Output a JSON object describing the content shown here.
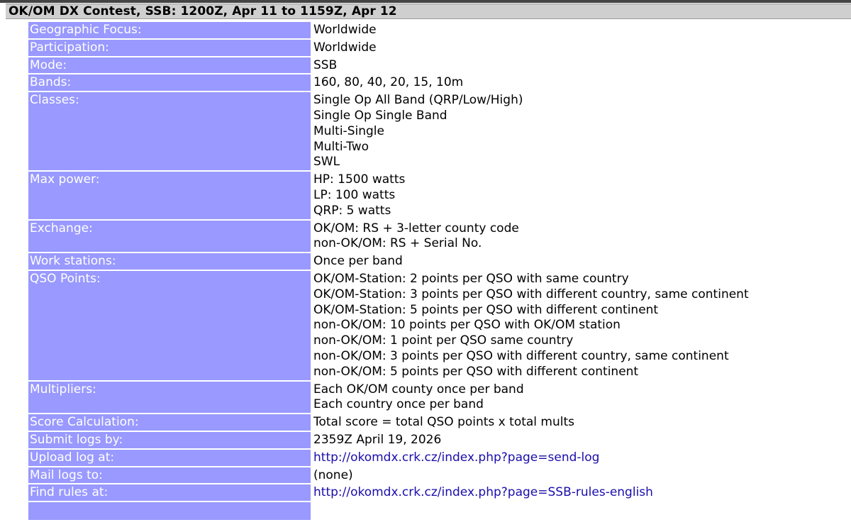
{
  "title": "OK/OM DX Contest, SSB: 1200Z, Apr 11 to 1159Z, Apr 12",
  "rows": [
    {
      "label": "Geographic Focus:",
      "lines": [
        "Worldwide"
      ]
    },
    {
      "label": "Participation:",
      "lines": [
        "Worldwide"
      ]
    },
    {
      "label": "Mode:",
      "lines": [
        "SSB"
      ]
    },
    {
      "label": "Bands:",
      "lines": [
        "160, 80, 40, 20, 15, 10m"
      ]
    },
    {
      "label": "Classes:",
      "lines": [
        "Single Op All Band (QRP/Low/High)",
        "Single Op Single Band",
        "Multi-Single",
        "Multi-Two",
        "SWL"
      ]
    },
    {
      "label": "Max power:",
      "lines": [
        "HP: 1500 watts",
        "LP: 100 watts",
        "QRP: 5 watts"
      ]
    },
    {
      "label": "Exchange:",
      "lines": [
        "OK/OM: RS + 3-letter county code",
        "non-OK/OM: RS + Serial No."
      ]
    },
    {
      "label": "Work stations:",
      "lines": [
        "Once per band"
      ]
    },
    {
      "label": "QSO Points:",
      "lines": [
        "OK/OM-Station: 2 points per QSO with same country",
        "OK/OM-Station: 3 points per QSO with different country, same continent",
        "OK/OM-Station: 5 points per QSO with different continent",
        "non-OK/OM: 10 points per QSO with OK/OM station",
        "non-OK/OM: 1 point per QSO same country",
        "non-OK/OM: 3 points per QSO with different country, same continent",
        "non-OK/OM: 5 points per QSO with different continent"
      ]
    },
    {
      "label": "Multipliers:",
      "lines": [
        "Each OK/OM county once per band",
        "Each country once per band"
      ]
    },
    {
      "label": "Score Calculation:",
      "lines": [
        "Total score = total QSO points x total mults"
      ]
    },
    {
      "label": "Submit logs by:",
      "lines": [
        "2359Z April 19, 2026"
      ]
    },
    {
      "label": "Upload log at:",
      "lines": [
        "http://okomdx.crk.cz/index.php?page=send-log"
      ]
    },
    {
      "label": "Mail logs to:",
      "lines": [
        "(none)"
      ]
    },
    {
      "label": "Find rules at:",
      "lines": [
        "http://okomdx.crk.cz/index.php?page=SSB-rules-english"
      ]
    }
  ],
  "colors": {
    "label_bg": "#9999ff",
    "label_text": "#ffffff",
    "title_bg": "#cfcfcf",
    "link": "#1a0dab"
  }
}
